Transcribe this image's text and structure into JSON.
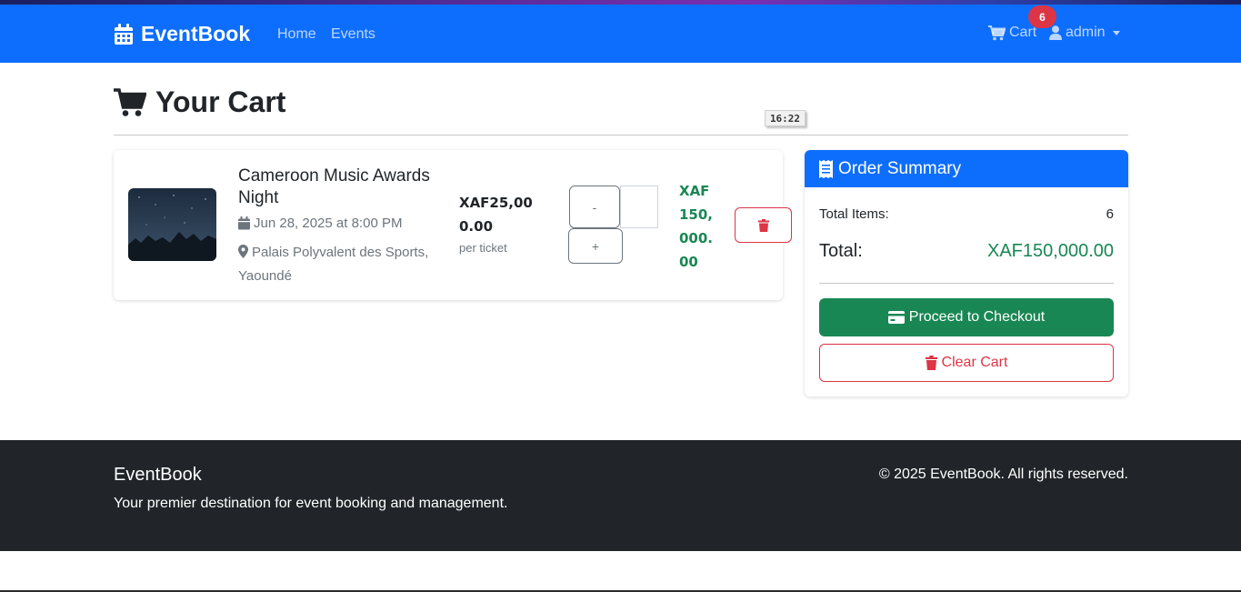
{
  "navbar": {
    "brand": "EventBook",
    "links": [
      {
        "label": "Home"
      },
      {
        "label": "Events"
      }
    ],
    "cart_label": "Cart",
    "cart_count": "6",
    "user_label": "admin",
    "bg_color": "#0d6efd"
  },
  "page": {
    "title": "Your Cart",
    "time_tooltip": "16:22"
  },
  "cart_items": [
    {
      "name": "Cameroon Music Awards Night",
      "date": "Jun 28, 2025 at 8:00 PM",
      "venue": "Palais Polyvalent des Sports, Yaoundé",
      "price": "XAF25,000.00",
      "price_note": "per ticket",
      "minus_label": "-",
      "plus_label": "+",
      "quantity": "",
      "subtotal": "XAF150,000.00"
    }
  ],
  "summary": {
    "title": "Order Summary",
    "items_label": "Total Items:",
    "items_value": "6",
    "total_label": "Total:",
    "total_value": "XAF150,000.00",
    "checkout_label": "Proceed to Checkout",
    "clear_label": "Clear Cart"
  },
  "footer": {
    "brand": "EventBook",
    "tagline": "Your premier destination for event booking and management.",
    "copyright": "© 2025 EventBook. All rights reserved."
  },
  "colors": {
    "primary": "#0d6efd",
    "success": "#198754",
    "danger": "#dc3545",
    "dark": "#212529"
  },
  "icons": [
    "calendar-icon",
    "cart-icon",
    "user-icon",
    "receipt-icon",
    "credit-card-icon",
    "trash-icon",
    "map-marker-icon"
  ]
}
